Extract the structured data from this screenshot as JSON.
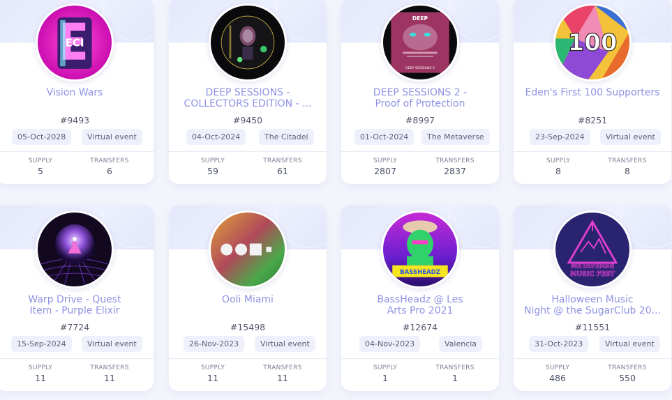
{
  "labels": {
    "supply": "SUPPLY",
    "transfers": "TRANSFERS"
  },
  "cards": [
    {
      "title": "Vision Wars",
      "token_id": "#9493",
      "date": "05-Oct-2028",
      "location": "Virtual event",
      "supply": "5",
      "transfers": "6",
      "image": "neon-glyph-art"
    },
    {
      "title": "DEEP SESSIONS -\nCOLLECTORS EDITION - ...",
      "token_id": "#9450",
      "date": "04-Oct-2024",
      "location": "The Citadel",
      "supply": "59",
      "transfers": "61",
      "image": "deep-sessions-poster"
    },
    {
      "title": "DEEP SESSIONS 2 -\nProof of Protection",
      "token_id": "#8997",
      "date": "01-Oct-2024",
      "location": "The Metaverse",
      "supply": "2807",
      "transfers": "2837",
      "image": "deep-sessions-2-poster"
    },
    {
      "title": "Eden's First 100 Supporters",
      "token_id": "#8251",
      "date": "23-Sep-2024",
      "location": "Virtual event",
      "supply": "8",
      "transfers": "8",
      "image": "colorful-100-badge"
    },
    {
      "title": "Warp Drive - Quest\nItem - Purple Elixir",
      "token_id": "#7724",
      "date": "15-Sep-2024",
      "location": "Virtual event",
      "supply": "11",
      "transfers": "11",
      "image": "purple-elixir-orb"
    },
    {
      "title": "Ooli Miami",
      "token_id": "#15498",
      "date": "26-Nov-2023",
      "location": "Virtual event",
      "supply": "11",
      "transfers": "11",
      "image": "ooli-gradient"
    },
    {
      "title": "BassHeadz @ Les\nArts Pro 2021",
      "token_id": "#12674",
      "date": "04-Nov-2023",
      "location": "Valencia",
      "supply": "1",
      "transfers": "1",
      "image": "bassheadz-character"
    },
    {
      "title": "Halloween Music\nNight @ the SugarClub 20...",
      "token_id": "#11551",
      "date": "31-Oct-2023",
      "location": "Virtual event",
      "supply": "486",
      "transfers": "550",
      "image": "metaverse-music-fest"
    }
  ],
  "image_texts": {
    "vision_wars_letters": "ECI",
    "badge_100": "100",
    "bassheadz_logo_text": "BASSHEADZ",
    "mmf_line1": "METAVERSE",
    "mmf_line2": "MUSIC FEST",
    "ds2_line1": "DEEP",
    "ds2_line2": "DEEP SESSIONS 2"
  }
}
